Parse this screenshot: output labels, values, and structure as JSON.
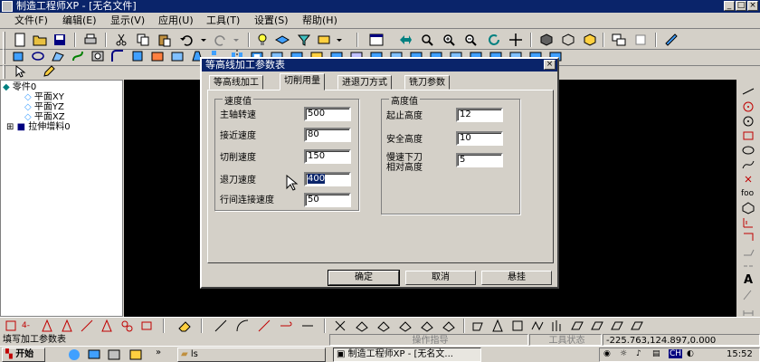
{
  "app": {
    "title": "制造工程师XP - [无名文件]",
    "window_controls": [
      "_",
      "□",
      "×"
    ]
  },
  "menu": [
    "文件(F)",
    "编辑(E)",
    "显示(V)",
    "应用(U)",
    "工具(T)",
    "设置(S)",
    "帮助(H)"
  ],
  "tree": {
    "root": "零件0",
    "items": [
      "平面XY",
      "平面YZ",
      "平面XZ",
      "拉伸增料0"
    ]
  },
  "dialog": {
    "title": "等高线加工参数表",
    "close": "×",
    "tabs": [
      "等高线加工",
      "切削用量",
      "进退刀方式",
      "铣刀参数"
    ],
    "active_tab": 1,
    "speed_group": {
      "label": "速度值",
      "fields": [
        {
          "label": "主轴转速",
          "value": "500"
        },
        {
          "label": "接近速度",
          "value": "80"
        },
        {
          "label": "切削速度",
          "value": "150"
        },
        {
          "label": "退刀速度",
          "value": "400"
        },
        {
          "label": "行间连接速度",
          "value": "50"
        }
      ]
    },
    "height_group": {
      "label": "高度值",
      "fields": [
        {
          "label": "起止高度",
          "value": "12"
        },
        {
          "label": "安全高度",
          "value": "10"
        },
        {
          "label": "慢速下刀",
          "label2": "相对高度",
          "value": "5"
        }
      ]
    },
    "buttons": {
      "ok": "确定",
      "cancel": "取消",
      "suspend": "悬挂"
    }
  },
  "status": {
    "prompt": "填写加工参数表",
    "guide": "操作指导",
    "tool_state": "工具状态",
    "coords": "-225.763,124.897,0.000"
  },
  "taskbar": {
    "start": "开始",
    "tasks": [
      "ls",
      "制造工程师XP - [无名文..."
    ],
    "lang": "CH",
    "time": "15:52"
  },
  "colors": {
    "title_bar": "#0a246a",
    "canvas": "#000000",
    "face": "#d4d0c8"
  }
}
